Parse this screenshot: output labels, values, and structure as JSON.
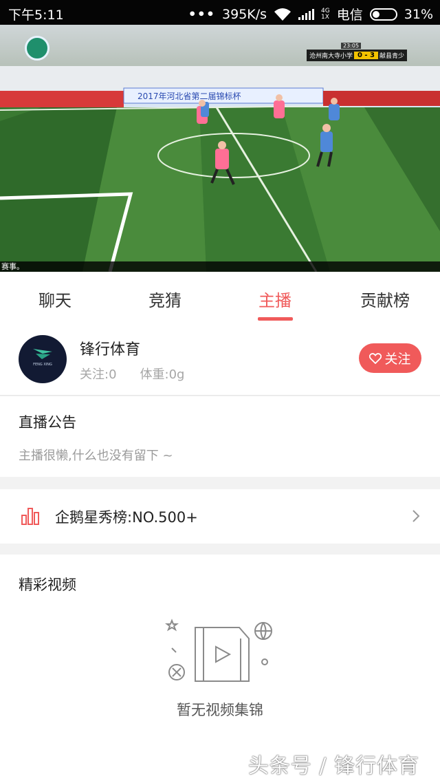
{
  "status_bar": {
    "time": "下午5:11",
    "dots": "•••",
    "net_speed": "395K/s",
    "network_type_top": "4G",
    "network_type_bottom": "1X",
    "carrier": "电信",
    "battery_percent": "31%",
    "battery_level": 0.31
  },
  "video": {
    "scoreboard": {
      "team_home": "沧州南大寺小学",
      "score": "0 - 3",
      "team_away": "献县青少",
      "clock": "23:05"
    },
    "banner_text": "2017年河北省第二届锦标杯",
    "ticker": "赛事。"
  },
  "tabs": [
    {
      "label": "聊天",
      "active": false
    },
    {
      "label": "竞猜",
      "active": false
    },
    {
      "label": "主播",
      "active": true
    },
    {
      "label": "贡献榜",
      "active": false
    }
  ],
  "anchor": {
    "name": "锋行体育",
    "follows": "关注:0",
    "weight": "体重:0g",
    "follow_button": "关注",
    "avatar_caption": "FENG XING"
  },
  "notice": {
    "title": "直播公告",
    "body": "主播很懒,什么也没有留下 ~"
  },
  "rank": {
    "label": "企鹅星秀榜:NO.500+"
  },
  "videos": {
    "title": "精彩视频",
    "empty_text": "暂无视频集锦",
    "watermark": "头条号 / 锋行体育"
  },
  "colors": {
    "accent": "#f05a5a",
    "status_bar": "#050505",
    "pitch": "#2d6b2a"
  }
}
